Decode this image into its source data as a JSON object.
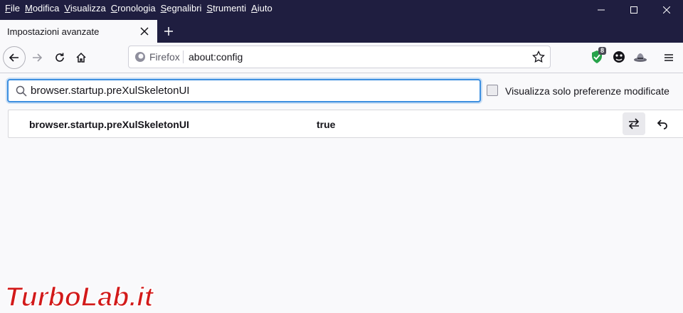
{
  "menubar": {
    "items": [
      {
        "accel": "F",
        "rest": "ile"
      },
      {
        "accel": "M",
        "rest": "odifica"
      },
      {
        "accel": "V",
        "rest": "isualizza"
      },
      {
        "accel": "C",
        "rest": "ronologia"
      },
      {
        "accel": "S",
        "rest": "egnalibri"
      },
      {
        "accel": "S",
        "rest": "trumenti"
      },
      {
        "accel": "A",
        "rest": "iuto"
      }
    ]
  },
  "tab": {
    "title": "Impostazioni avanzate"
  },
  "navbar": {
    "identity_label": "Firefox",
    "url": "about:config",
    "extension_badge": "8"
  },
  "config": {
    "search_value": "browser.startup.preXulSkeletonUI",
    "modified_only_label": "Visualizza solo preferenze modificate",
    "modified_only_checked": false,
    "pref": {
      "name": "browser.startup.preXulSkeletonUI",
      "value": "true"
    }
  },
  "watermark": {
    "text": "TurboLab.it"
  },
  "colors": {
    "chrome_bg": "#1f1e40",
    "accent": "#3d8fe0",
    "watermark_red": "#d21a1a"
  },
  "icons": [
    "back-arrow-icon",
    "forward-arrow-icon",
    "reload-icon",
    "home-icon",
    "firefox-logo-icon",
    "star-icon",
    "shield-extension-icon",
    "face-extension-icon",
    "hat-extension-icon",
    "hamburger-menu-icon",
    "search-icon",
    "toggle-icon",
    "reset-icon"
  ]
}
